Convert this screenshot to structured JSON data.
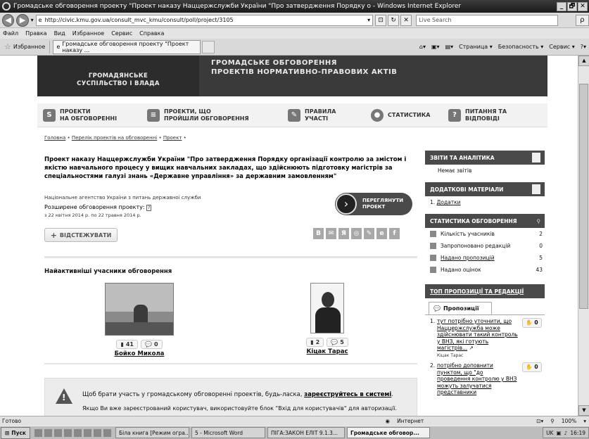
{
  "window": {
    "title": "Громадське обговорення проекту \"Проект наказу Наццержслужби України \"Про затвердження Порядку о - Windows Internet Explorer",
    "min": "_",
    "max": "🗗",
    "close": "✕"
  },
  "address": {
    "url": "http://civic.kmu.gov.ua/consult_mvc_kmu/consult/poll/project/3105",
    "search_placeholder": "Live Search",
    "search_btn": "ρ"
  },
  "menu": [
    "Файл",
    "Правка",
    "Вид",
    "Избранное",
    "Сервис",
    "Справка"
  ],
  "favorites": {
    "label": "Избранное",
    "tab_title": "Громадське обговорення проекту \"Проект наказу ...",
    "commands": [
      "Страница ▾",
      "Безопасность ▾",
      "Сервис ▾"
    ]
  },
  "banner": {
    "org": "ГРОМАДЯНСЬКЕ\nСУСПІЛЬСТВО І ВЛАДА",
    "title": "ГРОМАДСЬКЕ ОБГОВОРЕННЯ\nПРОЕКТІВ НОРМАТИВНО-ПРАВОВИХ АКТІВ"
  },
  "topnav": [
    {
      "label": "ПРОЕКТИ\nНА ОБГОВОРЕННІ",
      "icon": "S"
    },
    {
      "label": "ПРОЕКТИ, ЩО\nПРОЙШЛИ ОБГОВОРЕННЯ",
      "icon": "≡"
    },
    {
      "label": "ПРАВИЛА\nУЧАСТІ",
      "icon": "✎"
    },
    {
      "label": "СТАТИСТИКА",
      "icon": "●"
    },
    {
      "label": "ПИТАННЯ ТА\nВІДПОВІДІ",
      "icon": "?"
    }
  ],
  "breadcrumb": [
    "Головна",
    "Перелік проектів на обговоренні",
    "Проект"
  ],
  "project": {
    "title": "Проект наказу Наццержслужби України \"Про затвердження Порядку організації контролю за змістом і якістю навчального процесу у вищих навчальних закладах, що здійснюють підготовку магістрів за спеціальностями галузі знань «Державне управління» за державним замовленням\"",
    "agency": "Національне агентство України з питань державної служби",
    "discussion_label": "Розширене обговорення проекту:",
    "dates": "з 22 квітня 2014 р. по 22 травня 2014 р.",
    "view_button": "ПЕРЕГЛЯНУТИ\nПРОЕКТ",
    "track_button": "ВІДСТЕЖУВАТИ"
  },
  "social": [
    "B",
    "✉",
    "Я",
    "◎",
    "✎",
    "e",
    "f"
  ],
  "active": {
    "title": "Найактивніші учасники обговорення",
    "participants": [
      {
        "name": "Бойко Микола",
        "likes": "41",
        "comments": "0"
      },
      {
        "name": "Кіцак Тарас",
        "likes": "2",
        "comments": "5"
      }
    ]
  },
  "notice": {
    "line1_prefix": "Щоб брати участь у громадському обговоренні проектів, будь-ласка,",
    "line1_link": "зареєструйтесь в системі",
    "line1_suffix": ".",
    "line2": "Якщо Ви вже зареєстрований користувач, використовуйте блок \"Вхід для користувачів\" для авторизації."
  },
  "sidebar": {
    "reports": {
      "title": "ЗВІТИ ТА АНАЛІТИКА",
      "empty": "Немає звітів"
    },
    "materials": {
      "title": "ДОДАТКОВІ МАТЕРІАЛИ",
      "item": "Додатки",
      "num": "1."
    },
    "stats": {
      "title": "СТАТИСТИКА ОБГОВОРЕННЯ",
      "rows": [
        {
          "label": "Кількість учасників",
          "value": "2"
        },
        {
          "label": "Запропоновано редакцій",
          "value": "0"
        },
        {
          "label": "Надано пропозицій",
          "value": "5"
        },
        {
          "label": "Надано оцінок",
          "value": "43"
        }
      ]
    },
    "top": {
      "title": "ТОП ПРОПОЗИЦІЇ ТА РЕДАКЦІЇ",
      "tab": "Пропозиції",
      "items": [
        {
          "num": "1.",
          "text": "тут потрібно уточнити, що Наццержслужба може здійснювати такий контроль у ВНЗ, які готують магістрів...",
          "author": "Кіцак Тарас",
          "count": "0"
        },
        {
          "num": "2.",
          "text": "потрібно доповнити пунктом, що \"до проведення контролю у ВНЗ можуть залучатися представники",
          "count": "0"
        }
      ]
    }
  },
  "status": {
    "left": "Готово",
    "zone": "Интернет",
    "zoom": "100%"
  },
  "taskbar": {
    "start": "Пуск",
    "tasks": [
      "Біла книга [Режим огра...",
      "5 - Microsoft Word",
      "ПІГА:ЗАКОН ЕЛІТ 9.1.3...",
      "Громадське обговор..."
    ],
    "lang": "UK",
    "time": "16:19"
  }
}
